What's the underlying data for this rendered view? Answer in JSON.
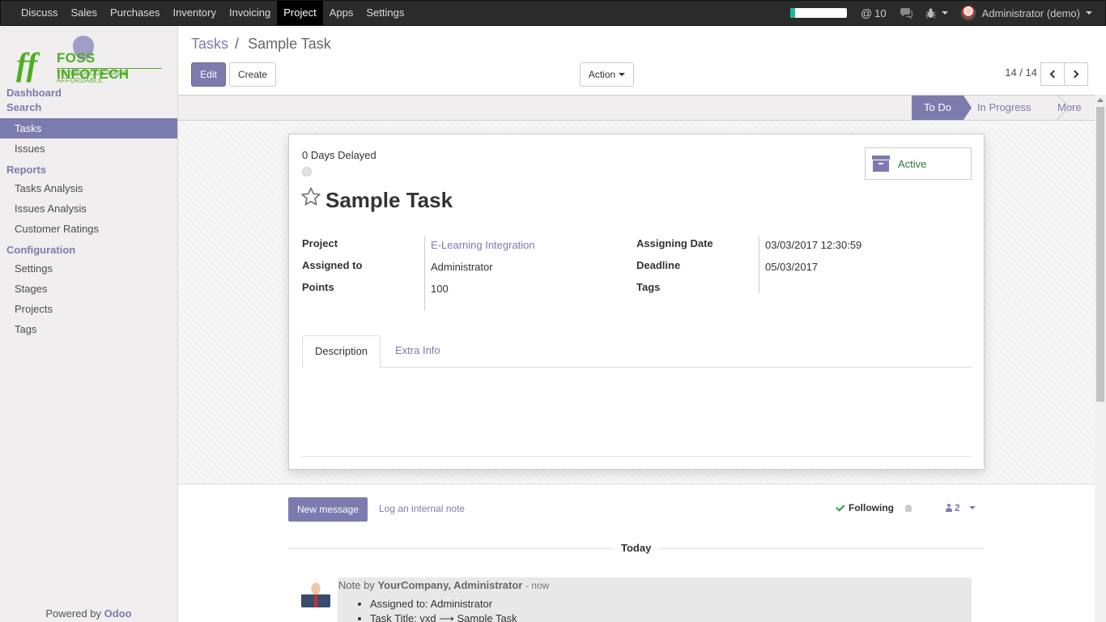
{
  "topbar": {
    "menu": [
      "Discuss",
      "Sales",
      "Purchases",
      "Inventory",
      "Invoicing",
      "Project",
      "Apps",
      "Settings"
    ],
    "active": "Project",
    "progress_fraction": 0.08,
    "mentions": "10",
    "user": "Administrator (demo)"
  },
  "sidebar": {
    "logo_brand": "FOSS INFOTECH",
    "logo_tagline": "TECHNOLOGY MADE AFFORDABLE",
    "links": [
      "Dashboard",
      "Search"
    ],
    "items1": [
      "Tasks",
      "Issues"
    ],
    "section_reports": "Reports",
    "reports": [
      "Tasks Analysis",
      "Issues Analysis",
      "Customer Ratings"
    ],
    "section_config": "Configuration",
    "config": [
      "Settings",
      "Stages",
      "Projects",
      "Tags"
    ],
    "powered_prefix": "Powered by",
    "powered_brand": "Odoo"
  },
  "control": {
    "breadcrumb_root": "Tasks",
    "breadcrumb_sep": "/",
    "breadcrumb_current": "Sample Task",
    "edit": "Edit",
    "create": "Create",
    "action": "Action",
    "pager": "14 / 14"
  },
  "stages": {
    "current": "To Do",
    "next": "In Progress",
    "more": "More"
  },
  "form": {
    "delayed": "0 Days Delayed",
    "active_label": "Active",
    "title": "Sample Task",
    "project_label": "Project",
    "project_value": "E-Learning Integration",
    "assigned_label": "Assigned to",
    "assigned_value": "Administrator",
    "points_label": "Points",
    "points_value": "100",
    "assign_date_label": "Assigning Date",
    "assign_date_value": "03/03/2017 12:30:59",
    "deadline_label": "Deadline",
    "deadline_value": "05/03/2017",
    "tags_label": "Tags",
    "tab_description": "Description",
    "tab_extra": "Extra Info"
  },
  "chatter": {
    "new_message": "New message",
    "log_note": "Log an internal note",
    "following": "Following",
    "followers_count": "2",
    "today": "Today",
    "msg_prefix": "Note by",
    "msg_author": "YourCompany, Administrator",
    "msg_time": "- now",
    "msg_line1": "Assigned to: Administrator",
    "msg_line2": "Task Title: vxd ⟶ Sample Task"
  },
  "colors": {
    "accent": "#7c7bad",
    "topbar": "#2b2b2b",
    "sidebar": "#f0eeee",
    "active_green": "#2f7a3a",
    "progress_fill": "#21b799"
  }
}
